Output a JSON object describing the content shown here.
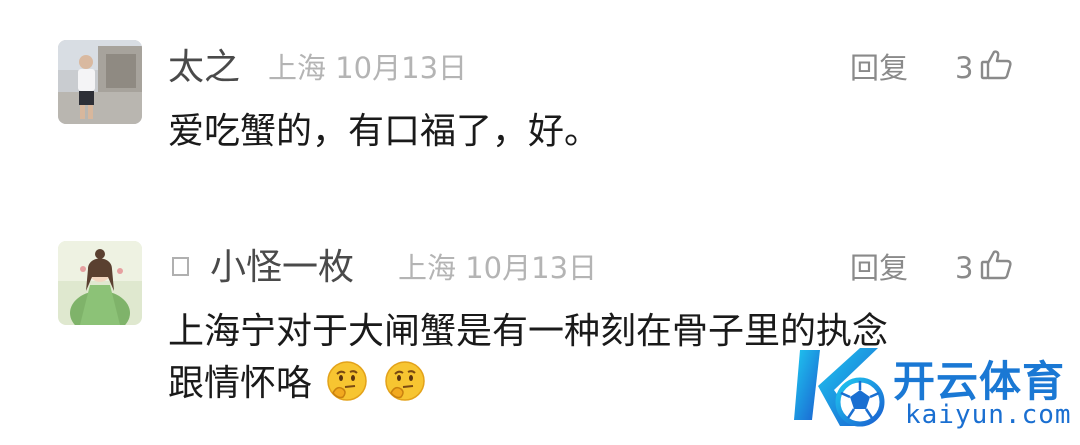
{
  "comments": [
    {
      "user": "太之",
      "location": "上海",
      "date": "10月13日",
      "reply_label": "回复",
      "likes": "3",
      "text_lines": [
        "爱吃蟹的，有口福了，好。"
      ]
    },
    {
      "user": "小怪一枚",
      "location": "上海",
      "date": "10月13日",
      "reply_label": "回复",
      "likes": "3",
      "text_lines": [
        "上海宁对于大闸蟹是有一种刻在骨子里的执念",
        "跟情怀咯"
      ]
    }
  ],
  "watermark": {
    "brand_cn": "开云体育",
    "brand_en": "kaiyun.com",
    "logo_letter": "K"
  },
  "colors": {
    "accent": "#1a78d4",
    "meta": "#b4b4b4",
    "action": "#8a8a8a"
  }
}
